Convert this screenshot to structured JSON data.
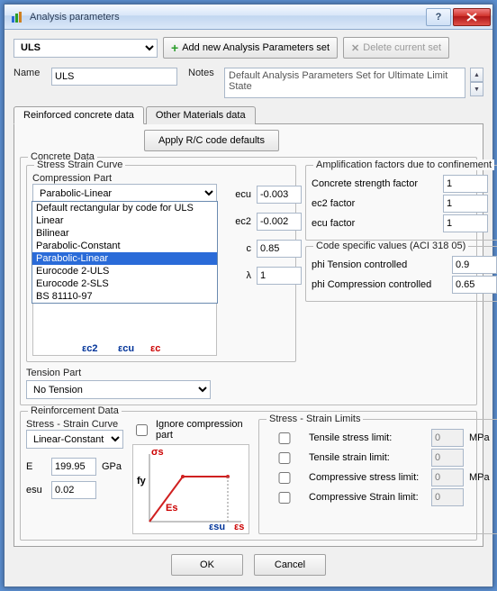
{
  "window": {
    "title": "Analysis parameters"
  },
  "top": {
    "selected_set": "ULS",
    "add_btn": "Add new Analysis Parameters set",
    "delete_btn": "Delete current set"
  },
  "fields": {
    "name_label": "Name",
    "name_value": "ULS",
    "notes_label": "Notes",
    "notes_value": "Default Analysis Parameters Set for Ultimate Limit State"
  },
  "tabs": {
    "t1": "Reinforced concrete data",
    "t2": "Other Materials data",
    "apply_btn": "Apply R/C code defaults"
  },
  "concrete": {
    "group": "Concrete Data",
    "stress_group": "Stress Strain Curve",
    "comp_label": "Compression Part",
    "comp_value": "Parabolic-Linear",
    "options": {
      "o1": "Default rectangular by code for ULS",
      "o2": "Linear",
      "o3": "Bilinear",
      "o4": "Parabolic-Constant",
      "o5": "Parabolic-Linear",
      "o6": "Eurocode 2-ULS",
      "o7": "Eurocode 2-SLS",
      "o8": "BS 81110-97"
    },
    "axis": {
      "ec2": "εc2",
      "ecu": "εcu",
      "ec": "εc"
    },
    "params": {
      "ecu_l": "ecu",
      "ecu_v": "-0.003",
      "ec2_l": "ec2",
      "ec2_v": "-0.002",
      "c_l": "c",
      "c_v": "0.85",
      "lam_l": "λ",
      "lam_v": "1"
    },
    "tension_label": "Tension Part",
    "tension_value": "No Tension"
  },
  "amp": {
    "group": "Amplification factors due to confinement",
    "r1_l": "Concrete strength factor",
    "r1_v": "1",
    "r2_l": "ec2 factor",
    "r2_v": "1",
    "r3_l": "ecu factor",
    "r3_v": "1",
    "code_group": "Code specific values (ACI 318 05)",
    "r4_l": "phi Tension controlled",
    "r4_v": "0.9",
    "r5_l": "phi Compression controlled",
    "r5_v": "0.65"
  },
  "reinf": {
    "group": "Reinforcement Data",
    "ss_label": "Stress - Strain Curve",
    "ss_value": "Linear-Constant",
    "ignore_label": "Ignore compression part",
    "E_l": "E",
    "E_v": "199.95",
    "E_unit": "GPa",
    "esu_l": "esu",
    "esu_v": "0.02",
    "graph": {
      "sigma": "σs",
      "fy": "fy",
      "Es": "Es",
      "esu": "εsu",
      "es": "εs"
    }
  },
  "limits": {
    "group": "Stress - Strain Limits",
    "r1_l": "Tensile stress limit:",
    "r1_v": "0",
    "r1_u": "MPa",
    "r2_l": "Tensile strain limit:",
    "r2_v": "0",
    "r2_u": "",
    "r3_l": "Compressive stress limit:",
    "r3_v": "0",
    "r3_u": "MPa",
    "r4_l": "Compressive Strain limit:",
    "r4_v": "0",
    "r4_u": ""
  },
  "footer": {
    "ok": "OK",
    "cancel": "Cancel"
  }
}
